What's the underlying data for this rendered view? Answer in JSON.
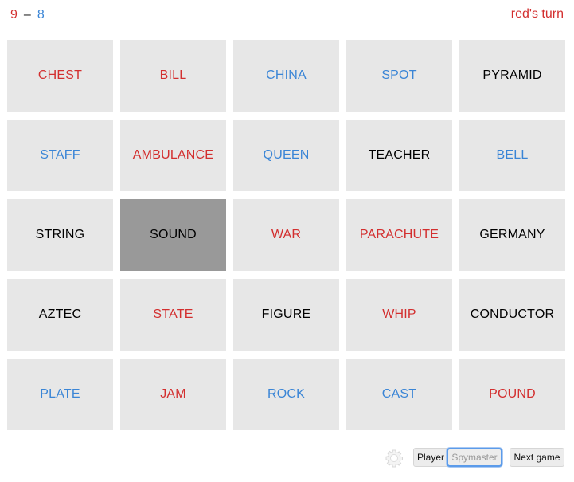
{
  "score": {
    "red": "9",
    "separator": "–",
    "blue": "8"
  },
  "turn": "red's turn",
  "colors": {
    "red": "#d32f2f",
    "blue": "#3a85d6",
    "neutral": "#000000",
    "card_bg": "#e7e7e7",
    "revealed_bg": "#999999"
  },
  "cards": [
    {
      "word": "CHEST",
      "team": "red",
      "revealed": false
    },
    {
      "word": "BILL",
      "team": "red",
      "revealed": false
    },
    {
      "word": "CHINA",
      "team": "blue",
      "revealed": false
    },
    {
      "word": "SPOT",
      "team": "blue",
      "revealed": false
    },
    {
      "word": "PYRAMID",
      "team": "black",
      "revealed": false
    },
    {
      "word": "STAFF",
      "team": "blue",
      "revealed": false
    },
    {
      "word": "AMBULANCE",
      "team": "red",
      "revealed": false
    },
    {
      "word": "QUEEN",
      "team": "blue",
      "revealed": false
    },
    {
      "word": "TEACHER",
      "team": "black",
      "revealed": false
    },
    {
      "word": "BELL",
      "team": "blue",
      "revealed": false
    },
    {
      "word": "STRING",
      "team": "black",
      "revealed": false
    },
    {
      "word": "SOUND",
      "team": "black",
      "revealed": true
    },
    {
      "word": "WAR",
      "team": "red",
      "revealed": false
    },
    {
      "word": "PARACHUTE",
      "team": "red",
      "revealed": false
    },
    {
      "word": "GERMANY",
      "team": "black",
      "revealed": false
    },
    {
      "word": "AZTEC",
      "team": "black",
      "revealed": false
    },
    {
      "word": "STATE",
      "team": "red",
      "revealed": false
    },
    {
      "word": "FIGURE",
      "team": "black",
      "revealed": false
    },
    {
      "word": "WHIP",
      "team": "red",
      "revealed": false
    },
    {
      "word": "CONDUCTOR",
      "team": "black",
      "revealed": false
    },
    {
      "word": "PLATE",
      "team": "blue",
      "revealed": false
    },
    {
      "word": "JAM",
      "team": "red",
      "revealed": false
    },
    {
      "word": "ROCK",
      "team": "blue",
      "revealed": false
    },
    {
      "word": "CAST",
      "team": "blue",
      "revealed": false
    },
    {
      "word": "POUND",
      "team": "red",
      "revealed": false
    }
  ],
  "controls": {
    "settings_icon": "gear-icon",
    "player_label": "Player",
    "spymaster_label": "Spymaster",
    "next_game_label": "Next game"
  }
}
